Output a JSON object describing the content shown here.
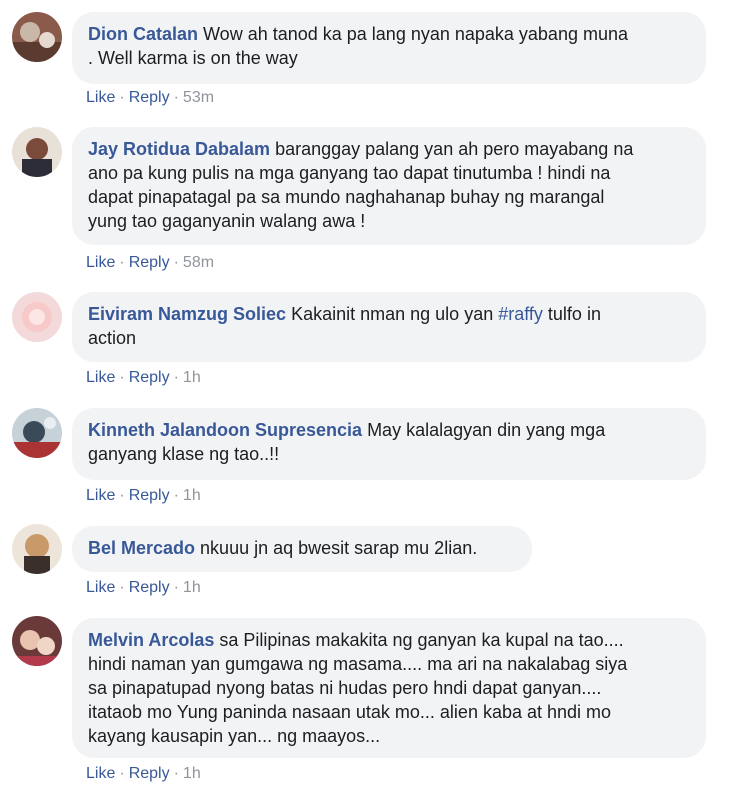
{
  "colors": {
    "author": "#385898",
    "bubble": "#f2f3f5",
    "meta": "#90949c"
  },
  "comments": [
    {
      "author": "Dion Catalan",
      "text_lines": [
        "Wow ah tanod ka pa lang nyan napaka yabang muna",
        ". Well karma is on the way"
      ],
      "like": "Like",
      "reply": "Reply",
      "time": "53m",
      "sep": "·"
    },
    {
      "author": "Jay Rotidua Dabalam",
      "text_lines": [
        "baranggay palang yan ah pero mayabang na",
        "ano pa kung pulis na mga ganyang tao dapat tinutumba ! hindi na",
        "dapat pinapatagal pa sa mundo naghahanap buhay ng marangal",
        "yung tao gaganyanin walang awa !"
      ],
      "like": "Like",
      "reply": "Reply",
      "time": "58m",
      "sep": "·"
    },
    {
      "author": "Eiviram Namzug Soliec",
      "text_before_tag": "Kakainit nman ng ulo yan ",
      "tag": "#raffy",
      "text_after_tag": " tulfo in",
      "text_line2": "action",
      "like": "Like",
      "reply": "Reply",
      "time": "1h",
      "sep": "·"
    },
    {
      "author": "Kinneth Jalandoon Supresencia",
      "text_lines": [
        "May kalalagyan din yang mga",
        "ganyang klase ng tao..!!"
      ],
      "like": "Like",
      "reply": "Reply",
      "time": "1h",
      "sep": "·"
    },
    {
      "author": "Bel Mercado",
      "text_lines": [
        "nkuuu jn aq bwesit sarap mu 2lian."
      ],
      "like": "Like",
      "reply": "Reply",
      "time": "1h",
      "sep": "·"
    },
    {
      "author": "Melvin Arcolas",
      "text_lines": [
        "sa Pilipinas makakita ng ganyan ka kupal na tao....",
        "hindi naman yan gumgawa ng masama.... ma ari na nakalabag siya",
        "sa pinapatupad nyong batas ni hudas pero hndi dapat ganyan....",
        "itataob mo Yung paninda nasaan utak mo... alien kaba at hndi mo",
        "kayang kausapin yan... ng maayos..."
      ],
      "like": "Like",
      "reply": "Reply",
      "time": "1h",
      "sep": "·"
    }
  ]
}
